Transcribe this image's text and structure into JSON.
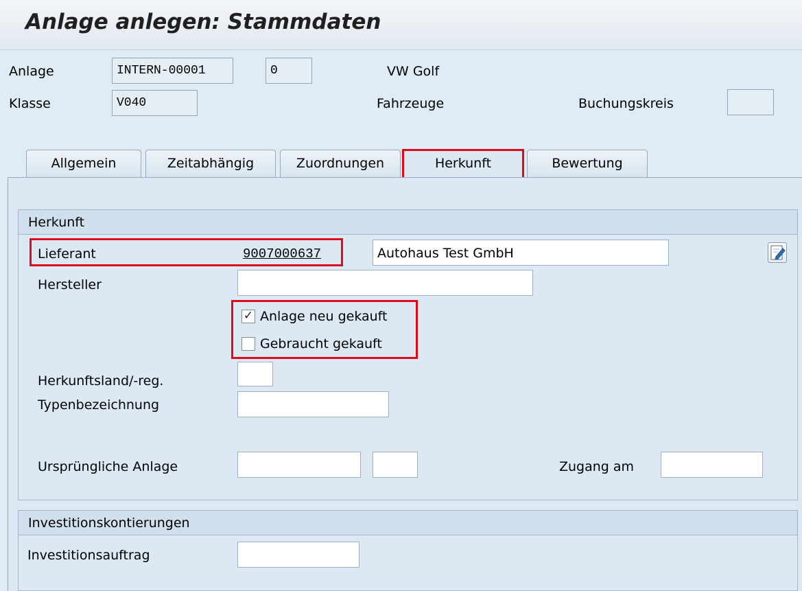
{
  "header": {
    "title": "Anlage anlegen:  Stammdaten"
  },
  "top": {
    "anlage_label": "Anlage",
    "anlage_value": "INTERN-00001",
    "anlage_sub_value": "0",
    "anlage_desc": "VW Golf",
    "klasse_label": "Klasse",
    "klasse_value": "V040",
    "klasse_desc": "Fahrzeuge",
    "buchungskreis_label": "Buchungskreis",
    "buchungskreis_value": ""
  },
  "tabs": [
    {
      "label": "Allgemein"
    },
    {
      "label": "Zeitabhängig"
    },
    {
      "label": "Zuordnungen"
    },
    {
      "label": "Herkunft"
    },
    {
      "label": "Bewertung"
    }
  ],
  "herkunft": {
    "title": "Herkunft",
    "lieferant_label": "Lieferant",
    "lieferant_value": "9007000637",
    "lieferant_name": "Autohaus Test GmbH",
    "hersteller_label": "Hersteller",
    "hersteller_value": "",
    "neu_gekauft_label": "Anlage neu gekauft",
    "neu_gekauft_checked": true,
    "gebraucht_label": "Gebraucht gekauft",
    "gebraucht_checked": false,
    "herkunftsland_label": "Herkunftsland/-reg.",
    "herkunftsland_value": "",
    "typenbezeichnung_label": "Typenbezeichnung",
    "typenbezeichnung_value": "",
    "urspruengliche_label": "Ursprüngliche Anlage",
    "urspruengliche_value": "",
    "urspruengliche_sub_value": "",
    "zugang_label": "Zugang am",
    "zugang_value": ""
  },
  "invest": {
    "title": "Investitionskontierungen",
    "auftrag_label": "Investitionsauftrag",
    "auftrag_value": ""
  },
  "colors": {
    "highlight": "#e00a1a",
    "panel": "#dce9f4"
  },
  "icons": {
    "edit": "edit-pencil-icon",
    "check": "checkmark-icon"
  }
}
